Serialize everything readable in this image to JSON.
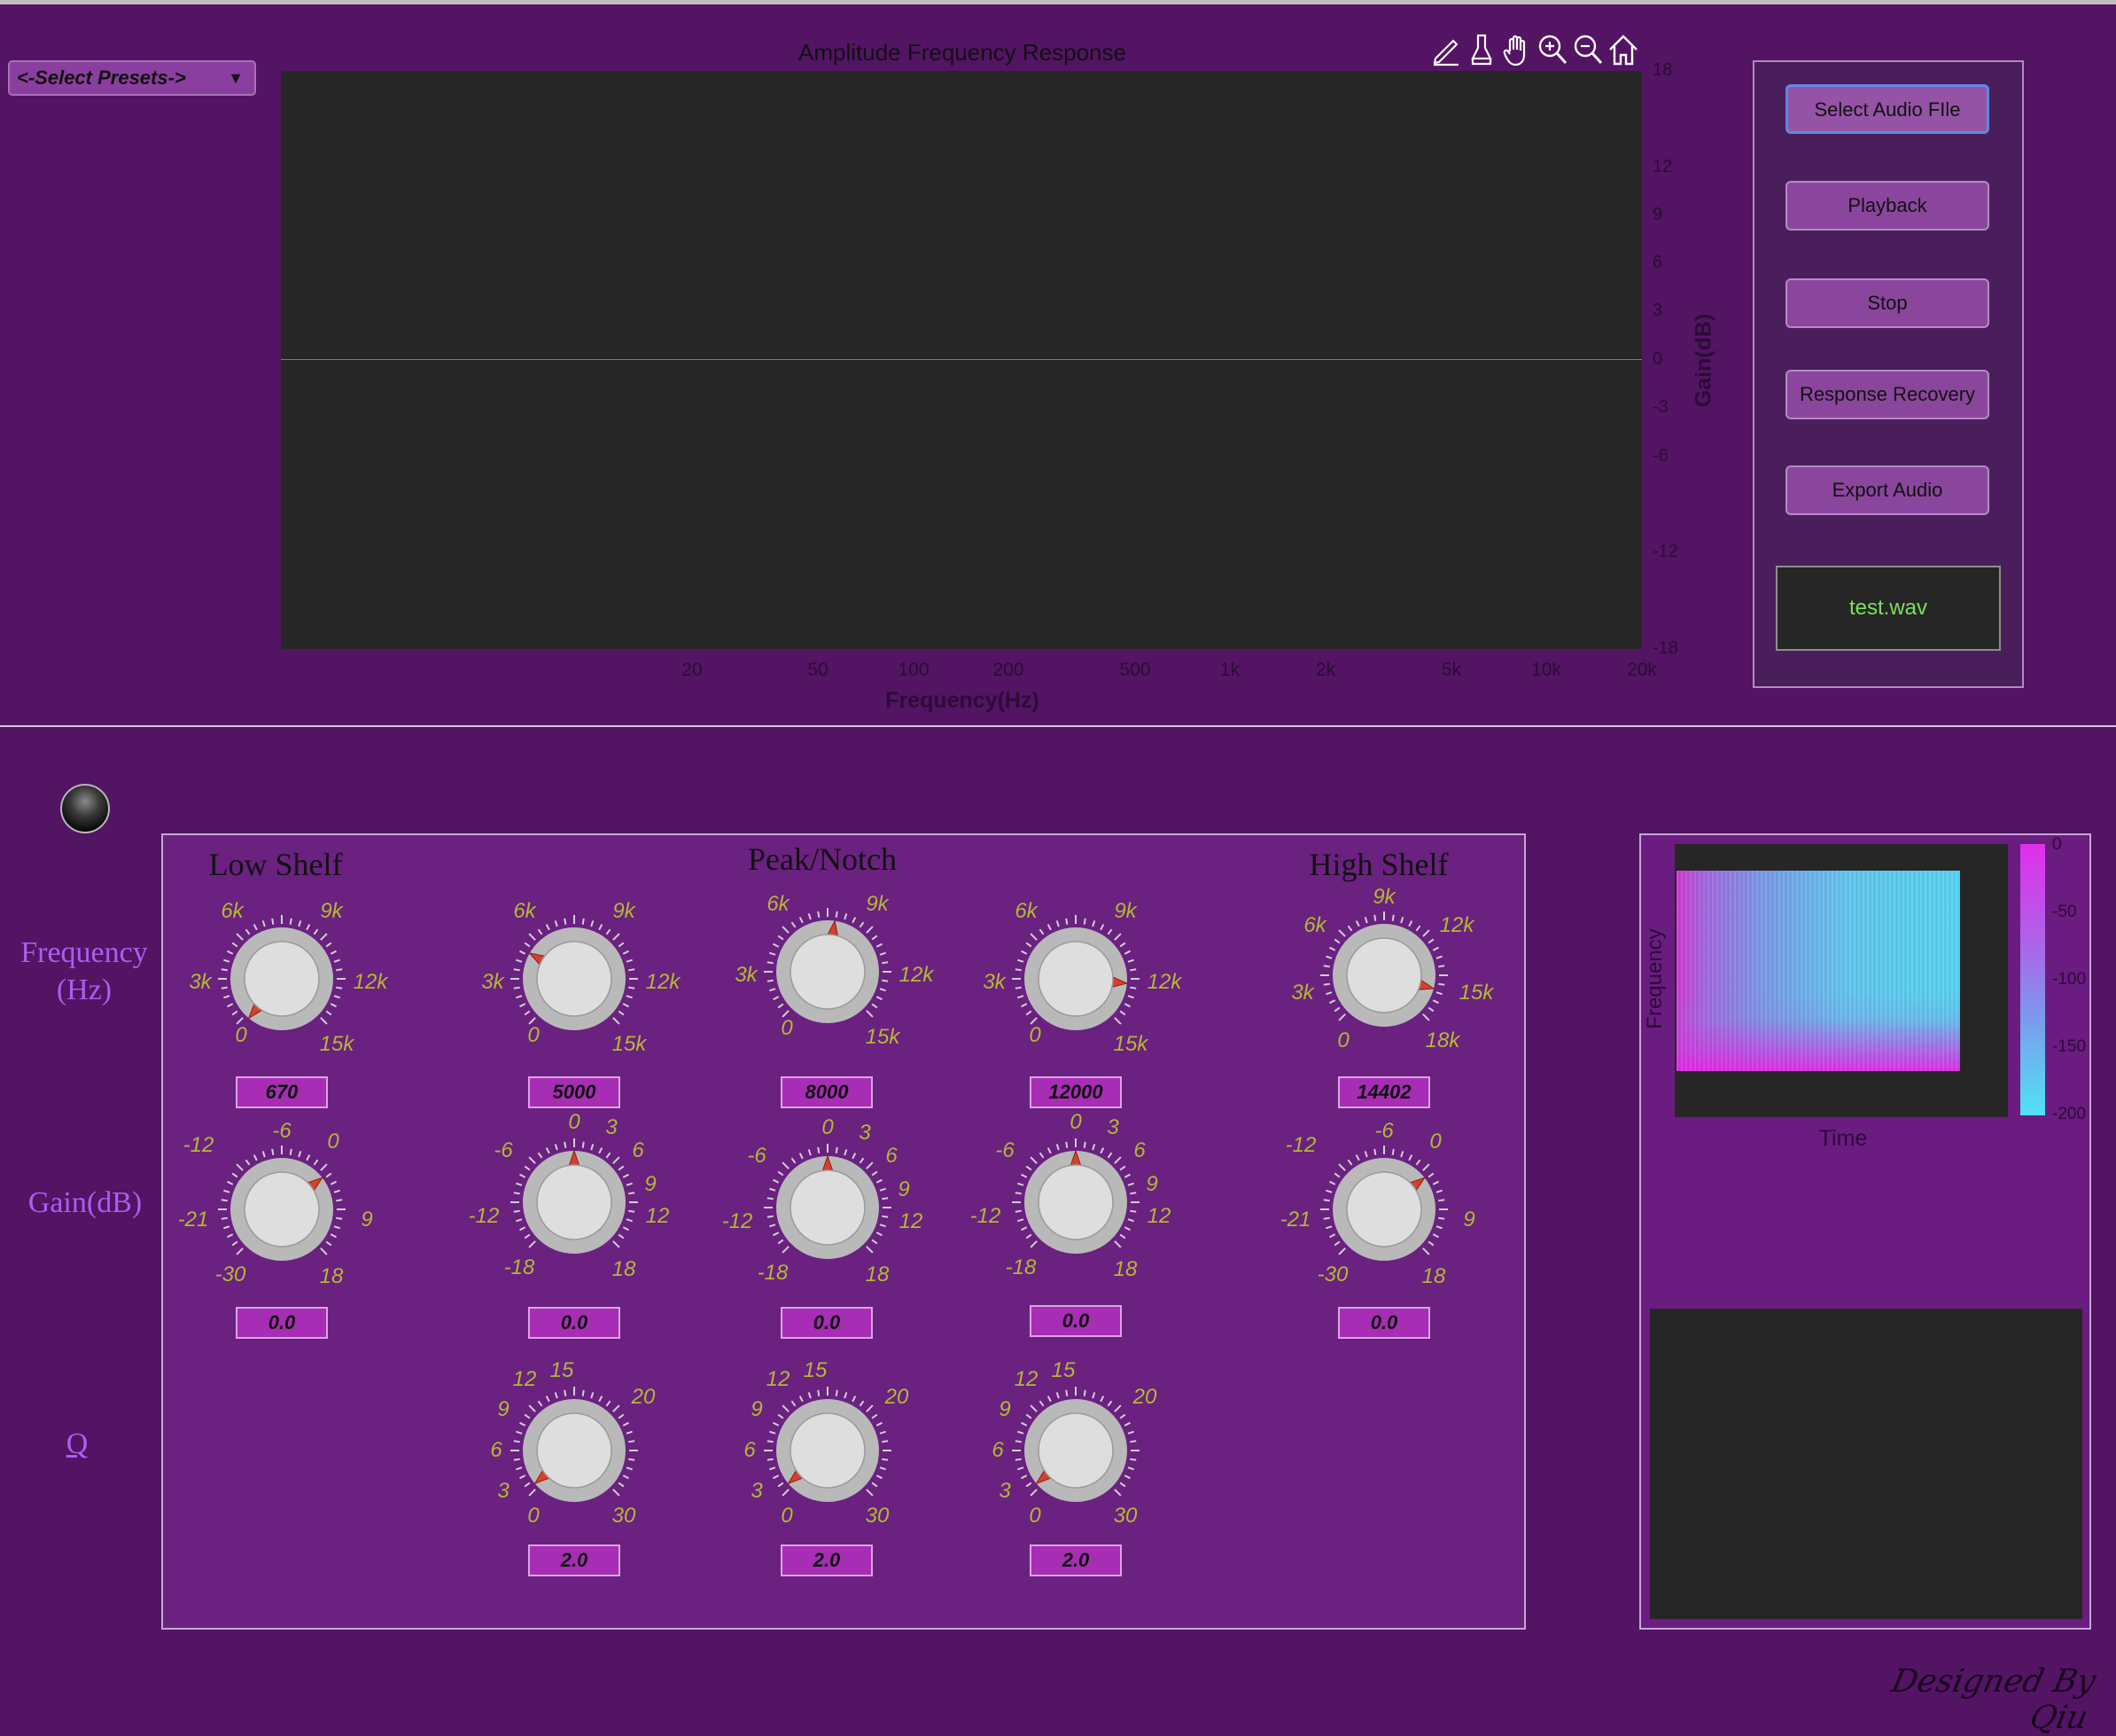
{
  "presets": {
    "label": "<-Select Presets->",
    "arrow": "▼"
  },
  "response_plot": {
    "title": "Amplitude Frequency Response",
    "xlabel": "Frequency(Hz)",
    "ylabel": "Gain(dB)",
    "x_ticks": [
      "20",
      "50",
      "100",
      "200",
      "500",
      "1k",
      "2k",
      "5k",
      "10k",
      "20k"
    ],
    "y_ticks": [
      "18",
      "12",
      "9",
      "6",
      "3",
      "0",
      "-3",
      "-6",
      "-12",
      "-18"
    ],
    "toolbar": [
      "edit-icon",
      "brush-icon",
      "pan-hand-icon",
      "zoom-in-icon",
      "zoom-out-icon",
      "home-icon"
    ]
  },
  "controls": {
    "select_file": "Select Audio FIle",
    "playback": "Playback",
    "stop": "Stop",
    "response_recovery": "Response Recovery",
    "export_audio": "Export Audio",
    "file_name": "test.wav"
  },
  "row_labels": {
    "frequency": "Frequency\n(Hz)",
    "gain": "Gain(dB)",
    "q": "Q"
  },
  "bands": {
    "low_shelf": "Low Shelf",
    "peak_notch": "Peak/Notch",
    "high_shelf": "High Shelf"
  },
  "knob_values": {
    "ls_freq": "670",
    "pk1_freq": "5000",
    "pk2_freq": "8000",
    "pk3_freq": "12000",
    "hs_freq": "14402",
    "ls_gain": "0.0",
    "pk1_gain": "0.0",
    "pk2_gain": "0.0",
    "pk3_gain": "0.0",
    "hs_gain": "0.0",
    "pk1_q": "2.0",
    "pk2_q": "2.0",
    "pk3_q": "2.0"
  },
  "scales": {
    "freq": [
      "0",
      "3k",
      "6k",
      "9k",
      "12k",
      "15k"
    ],
    "freq_hs": [
      "0",
      "3k",
      "6k",
      "9k",
      "12k",
      "15k",
      "18k"
    ],
    "gain_shelf": [
      "-30",
      "-21",
      "-12",
      "-6",
      "0",
      "9",
      "18"
    ],
    "gain_peak": [
      "-18",
      "-12",
      "-6",
      "0",
      "3",
      "6",
      "9",
      "12",
      "18"
    ],
    "q": [
      "0",
      "3",
      "6",
      "9",
      "12",
      "15",
      "20",
      "30"
    ]
  },
  "spectrogram": {
    "ylabel": "Frequency",
    "xlabel": "Time",
    "colorbar_ticks": [
      "0",
      "-50",
      "-100",
      "-150",
      "-200"
    ]
  },
  "signature": "Designed By Qiu",
  "colors": {
    "background": "#521463",
    "panel": "#6a2180",
    "accent_text": "#b05bf2",
    "scale_text": "#b3b832",
    "file_text": "#79e25a"
  }
}
